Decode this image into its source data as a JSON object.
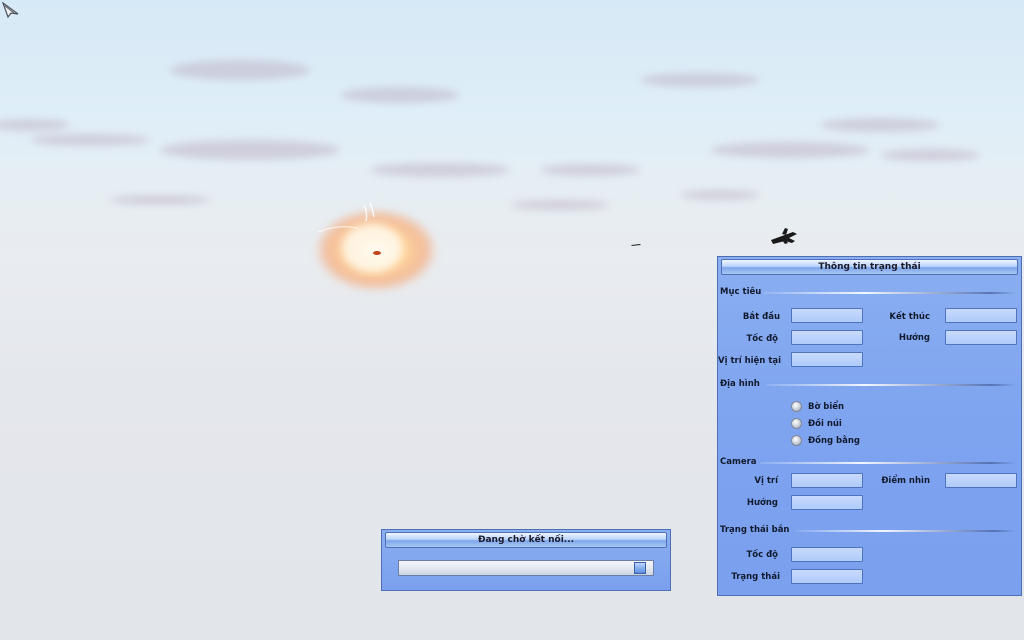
{
  "status_panel": {
    "title": "Thông tin trạng thái",
    "target": {
      "heading": "Mục tiêu",
      "start_label": "Bắt đầu",
      "end_label": "Kết thúc",
      "speed_label": "Tốc độ",
      "direction_label": "Hướng",
      "current_position_label": "Vị trí hiện tại",
      "start_value": "",
      "end_value": "",
      "speed_value": "",
      "direction_value": "",
      "current_position_value": ""
    },
    "terrain": {
      "heading": "Địa hình",
      "options": [
        "Bờ biển",
        "Đồi núi",
        "Đồng bằng"
      ]
    },
    "camera": {
      "heading": "Camera",
      "position_label": "Vị trí",
      "viewpoint_label": "Điểm nhìn",
      "direction_label": "Hướng",
      "position_value": "",
      "viewpoint_value": "",
      "direction_value": ""
    },
    "fire_status": {
      "heading": "Trạng thái bắn",
      "speed_label": "Tốc độ",
      "status_label": "Trạng thái",
      "speed_value": "",
      "status_value": ""
    }
  },
  "connection_dialog": {
    "title": "Đang chờ kết nối...",
    "progress": 0.97
  },
  "colors": {
    "panel_bg": "#7ea4f0",
    "titlebar": "#bcd4fa",
    "field_bg": "#aecbfa",
    "sky_top": "#d6e9f6",
    "haze": "#e4e7ec",
    "explosion": "#ffcf88"
  }
}
